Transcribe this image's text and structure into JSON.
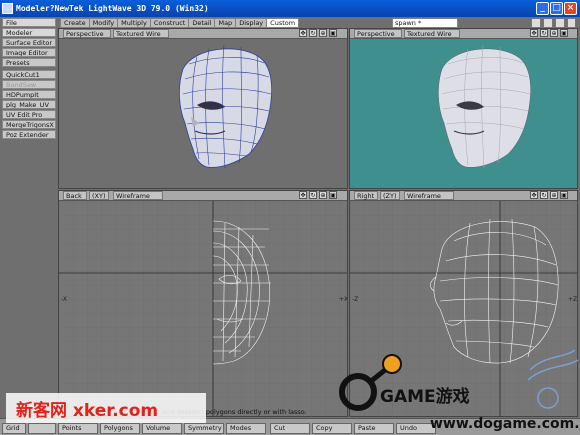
{
  "window": {
    "title": "Modeler?NewTek LightWave 3D 79.0 (Win32)"
  },
  "left_menu": {
    "items": [
      "File",
      "Modeler",
      "Surface Editor",
      "Image Editor",
      "Presets"
    ],
    "plugins": [
      "QuickCut1",
      "BandSaw",
      "HDPumpIt",
      "plg_Make_UV_",
      "UV Edit Pro",
      "MergeTrigonsX",
      "Poz Extender"
    ]
  },
  "tabs": [
    "Create",
    "Modify",
    "Multiply",
    "Construct",
    "Detail",
    "Map",
    "Display",
    "Custom"
  ],
  "active_tab": "Custom",
  "layer": "spawn *",
  "viewports": {
    "top_left": {
      "view": "Perspective",
      "mode": "Textured Wire"
    },
    "top_right": {
      "view": "Perspective",
      "mode": "Textured Wire"
    },
    "bottom_left": {
      "view": "Back",
      "axes": "(XY)",
      "mode": "Wireframe"
    },
    "bottom_right": {
      "view": "Right",
      "axes": "(ZY)",
      "mode": "Wireframe"
    }
  },
  "status": "Select and deselect polygons directly or with lasso.",
  "bottom_bar": {
    "buttons": [
      "Grid",
      "",
      "Points",
      "Polygons",
      "Volume",
      "Symmetry",
      "Modes",
      "Cut",
      "Copy",
      "Paste",
      "Undo"
    ]
  },
  "watermarks": {
    "left": "新客网 xker.com",
    "brand": "GAME游戏",
    "url": "www.dogame.com.cn"
  },
  "colors": {
    "titlebar": "#0843b0",
    "viewport_bg": "#6f6f6f",
    "perspective_bg_right": "#3e8f8e",
    "wire": "#2c3fa0",
    "head_fill": "#d9d9e3"
  }
}
